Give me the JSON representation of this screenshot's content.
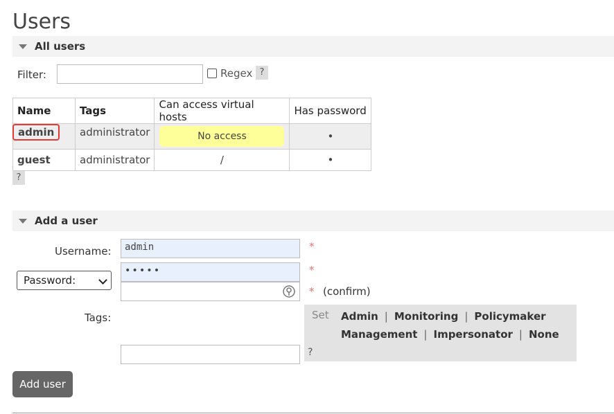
{
  "page": {
    "title": "Users"
  },
  "all_users": {
    "header": "All users",
    "filter_label": "Filter:",
    "filter_value": "",
    "regex_label": "Regex",
    "help_label": "?",
    "columns": [
      "Name",
      "Tags",
      "Can access virtual hosts",
      "Has password"
    ],
    "rows": [
      {
        "name": "admin",
        "tags": "administrator",
        "vhosts": "No access",
        "has_password": "•"
      },
      {
        "name": "guest",
        "tags": "administrator",
        "vhosts": "/",
        "has_password": "•"
      }
    ],
    "table_help": "?"
  },
  "add_user": {
    "header": "Add a user",
    "username_label": "Username:",
    "username_value": "admin",
    "password_select": "Password:",
    "password_value": "•••••",
    "confirm_label": "(confirm)",
    "required_mark": "*",
    "tags_label": "Tags:",
    "tags_value": "",
    "set_label": "Set",
    "tag_options": [
      "Admin",
      "Monitoring",
      "Policymaker",
      "Management",
      "Impersonator",
      "None"
    ],
    "separator": "|",
    "tags_help": "?",
    "add_button": "Add user"
  },
  "colors": {
    "no_access_bg": "#ffff99",
    "highlight_border": "#e53935",
    "button_bg": "#666666"
  }
}
